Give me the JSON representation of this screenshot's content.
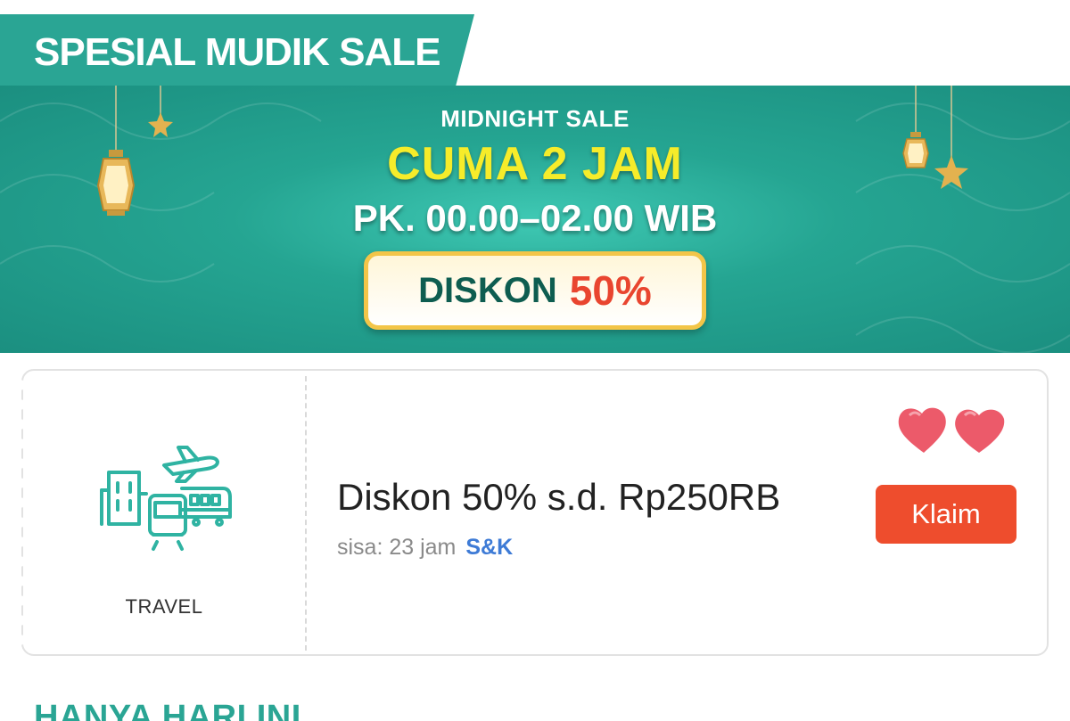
{
  "section": {
    "title": "SPESIAL MUDIK SALE"
  },
  "banner": {
    "subtitle": "MIDNIGHT SALE",
    "headline": "CUMA 2 JAM",
    "time_range": "PK. 00.00–02.00 WIB",
    "discount_label": "DISKON",
    "discount_value": "50%"
  },
  "voucher": {
    "category": "TRAVEL",
    "category_icon": "travel-icon",
    "title": "Diskon 50% s.d. Rp250RB",
    "remaining": "sisa: 23 jam",
    "terms_link": "S&K",
    "claim_label": "Klaim",
    "decoration_icon": "hearts-icon"
  },
  "next_section": {
    "title": "HANYA HARI INI"
  },
  "colors": {
    "brand_teal": "#2aa594",
    "claim_orange": "#ee4d2d",
    "headline_yellow": "#f6ec2a",
    "discount_red": "#e9452f",
    "link_blue": "#3e7bd6"
  }
}
